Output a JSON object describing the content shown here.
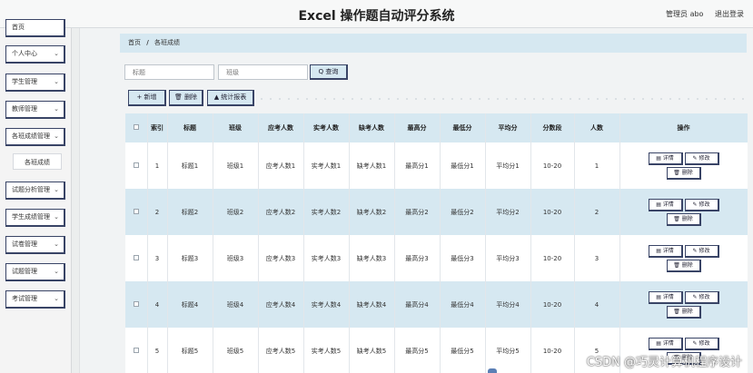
{
  "header": {
    "title": "Excel 操作题自动评分系统",
    "user": "管理员 abo",
    "logout": "退出登录"
  },
  "sidebar": {
    "items": [
      {
        "label": "首页",
        "chevron": ""
      },
      {
        "label": "个人中心",
        "chevron": "⌄"
      },
      {
        "label": "学生管理",
        "chevron": "⌄"
      },
      {
        "label": "教师管理",
        "chevron": "⌄"
      },
      {
        "label": "各班成绩管理",
        "chevron": "⌄"
      },
      {
        "label": "试题分析管理",
        "chevron": "⌄"
      },
      {
        "label": "学生成绩管理",
        "chevron": "⌄"
      },
      {
        "label": "试卷管理",
        "chevron": "⌄"
      },
      {
        "label": "试题管理",
        "chevron": "⌄"
      },
      {
        "label": "考试管理",
        "chevron": "⌄"
      }
    ],
    "subitem": "各班成绩"
  },
  "breadcrumb": {
    "home": "首页",
    "sep": "/",
    "current": "各班成绩"
  },
  "search": {
    "title_placeholder": "标题",
    "class_placeholder": "班级",
    "query_label": "Q 查询"
  },
  "toolbar": {
    "add_label": "+ 新增",
    "delete_label": "🗑 删除",
    "stats_label": "▲ 统计报表"
  },
  "table": {
    "columns": [
      "",
      "索引",
      "标题",
      "班级",
      "应考人数",
      "实考人数",
      "缺考人数",
      "最高分",
      "最低分",
      "平均分",
      "分数段",
      "人数",
      "操作"
    ],
    "actions": {
      "detail": "▤ 详情",
      "edit": "✎ 修改",
      "delete": "🗑 删除"
    },
    "rows": [
      [
        "1",
        "标题1",
        "班级1",
        "应考人数1",
        "实考人数1",
        "缺考人数1",
        "最高分1",
        "最低分1",
        "平均分1",
        "10-20",
        "1"
      ],
      [
        "2",
        "标题2",
        "班级2",
        "应考人数2",
        "实考人数2",
        "缺考人数2",
        "最高分2",
        "最低分2",
        "平均分2",
        "10-20",
        "2"
      ],
      [
        "3",
        "标题3",
        "班级3",
        "应考人数3",
        "实考人数3",
        "缺考人数3",
        "最高分3",
        "最低分3",
        "平均分3",
        "10-20",
        "3"
      ],
      [
        "4",
        "标题4",
        "班级4",
        "应考人数4",
        "实考人数4",
        "缺考人数4",
        "最高分4",
        "最低分4",
        "平均分4",
        "10-20",
        "4"
      ],
      [
        "5",
        "标题5",
        "班级5",
        "应考人数5",
        "实考人数5",
        "缺考人数5",
        "最高分5",
        "最低分5",
        "平均分5",
        "10-20",
        "5"
      ]
    ]
  },
  "watermark": "CSDN @巧灵计算机程序设计"
}
